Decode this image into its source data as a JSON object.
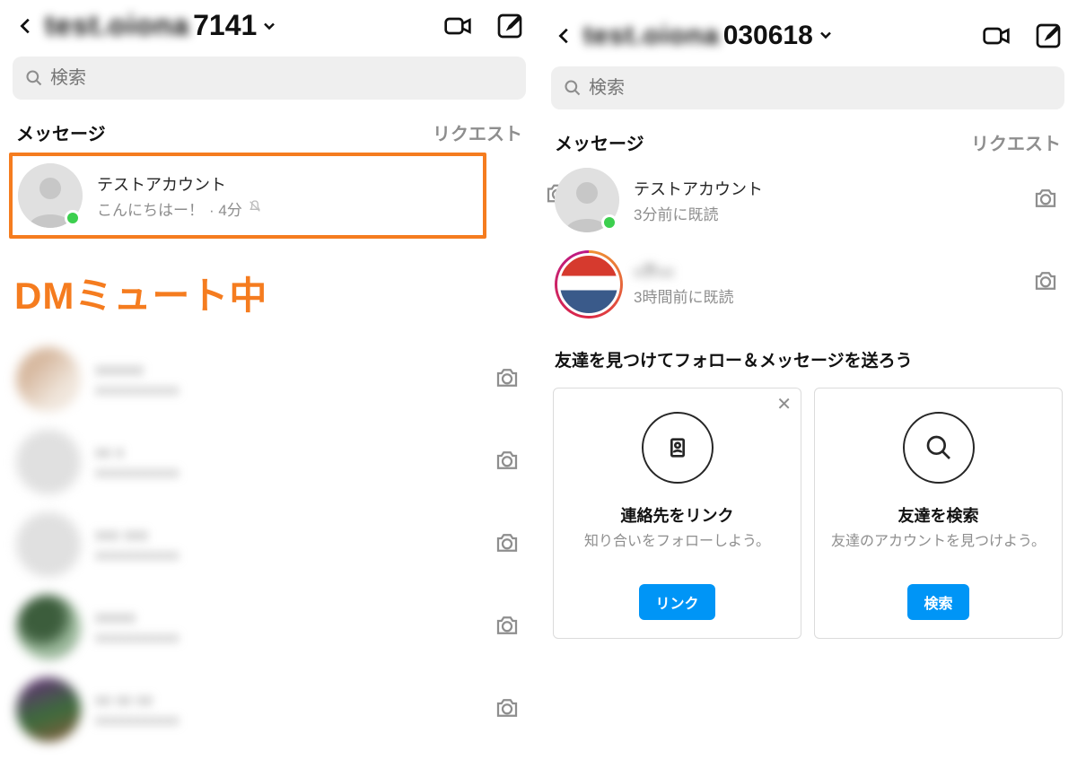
{
  "left": {
    "header": {
      "username_blur": "test.oiona",
      "username_suffix": "7141"
    },
    "search_placeholder": "検索",
    "tabs": {
      "messages": "メッセージ",
      "requests": "リクエスト"
    },
    "highlight": {
      "name": "テストアカウント",
      "preview": "こんにちはー！",
      "time": "· 4分"
    },
    "big_label": "DMミュート中",
    "rows": [
      {
        "name": "xxxxxx",
        "sub": "xxxxxxxxxxx"
      },
      {
        "name": "xx x",
        "sub": "xxxxxxxxxxx"
      },
      {
        "name": "xxx xxx",
        "sub": "xxxxxxxxxxx"
      },
      {
        "name": "xxxxx",
        "sub": "xxxxxxxxxxx"
      },
      {
        "name": "xx xx xx",
        "sub": "xxxxxxxxxxx"
      }
    ]
  },
  "right": {
    "header": {
      "username_blur": "test.oiona",
      "username_suffix": "030618"
    },
    "search_placeholder": "検索",
    "tabs": {
      "messages": "メッセージ",
      "requests": "リクエスト"
    },
    "rows": [
      {
        "name": "テストアカウント",
        "sub": "3分前に既読",
        "presence": true
      },
      {
        "name": "x界xx",
        "sub": "3時間前に既読",
        "story": true
      }
    ],
    "suggest_title": "友達を見つけてフォロー＆メッセージを送ろう",
    "cards": [
      {
        "title": "連絡先をリンク",
        "sub": "知り合いをフォローしよう。",
        "btn": "リンク",
        "closable": true,
        "icon": "contact"
      },
      {
        "title": "友達を検索",
        "sub": "友達のアカウントを見つけよう。",
        "btn": "検索",
        "closable": false,
        "icon": "search"
      }
    ]
  }
}
